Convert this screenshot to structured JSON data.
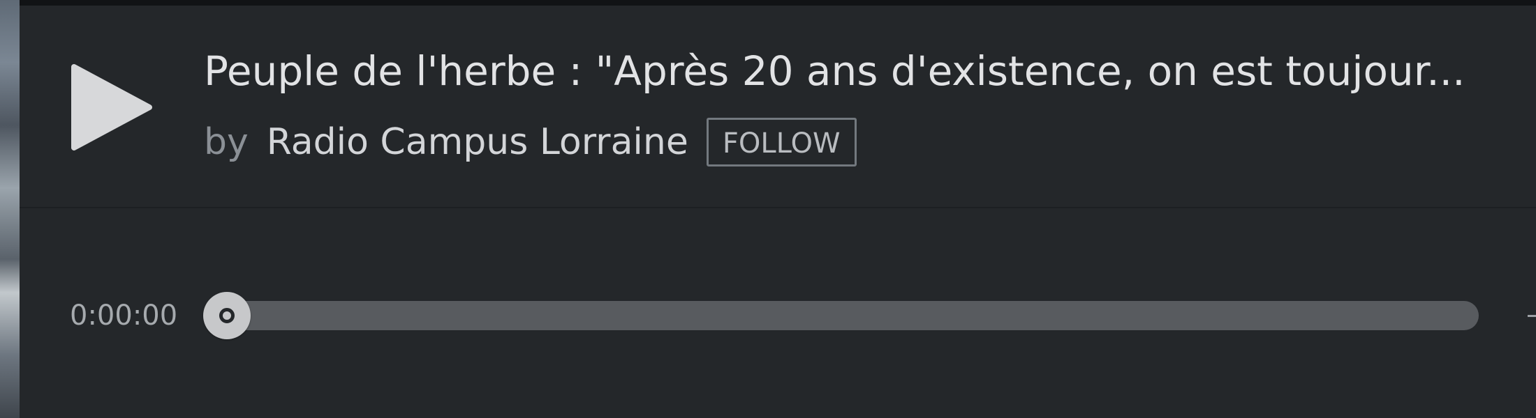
{
  "episode": {
    "title": "Peuple de l'herbe : \"Après 20 ans d'existence, on est toujour...",
    "by_label": "by",
    "author": "Radio Campus Lorraine",
    "follow_label": "FOLLOW"
  },
  "player": {
    "current_time": "0:00:00",
    "progress": 0,
    "play_icon": "play-icon"
  },
  "colors": {
    "panel": "#24272a",
    "track": "#585b5f",
    "scrubber": "#c7c8ca",
    "text": "#e2e3e5"
  }
}
